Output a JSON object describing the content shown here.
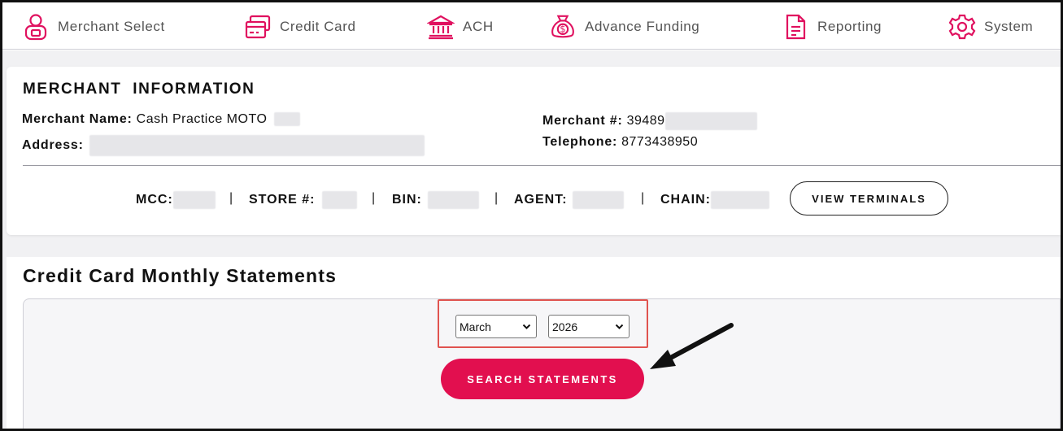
{
  "nav": {
    "items": [
      {
        "label": "Merchant Select",
        "icon": "user-lock-icon"
      },
      {
        "label": "Credit Card",
        "icon": "credit-card-icon"
      },
      {
        "label": "ACH",
        "icon": "bank-icon"
      },
      {
        "label": "Advance Funding",
        "icon": "money-bag-icon"
      },
      {
        "label": "Reporting",
        "icon": "document-icon"
      },
      {
        "label": "System",
        "icon": "gear-icon"
      }
    ],
    "icon_color": "#e0115f"
  },
  "merchant_info": {
    "title": "MERCHANT  INFORMATION",
    "name_label": "Merchant Name:",
    "name_value": "Cash Practice MOTO",
    "address_label": "Address:",
    "merchant_no_label": "Merchant #:",
    "merchant_no_value": "39489",
    "telephone_label": "Telephone:",
    "telephone_value": "8773438950",
    "mcc_label": "MCC:",
    "store_label": "STORE #:",
    "bin_label": "BIN:",
    "agent_label": "AGENT:",
    "chain_label": "CHAIN:",
    "separator": "|",
    "view_terminals_label": "VIEW TERMINALS"
  },
  "statements": {
    "title": "Credit Card Monthly Statements",
    "month_selected": "March",
    "year_selected": "2026",
    "search_label": "SEARCH STATEMENTS",
    "accent_color": "#e20f4f",
    "highlight_color": "#e0534f"
  }
}
